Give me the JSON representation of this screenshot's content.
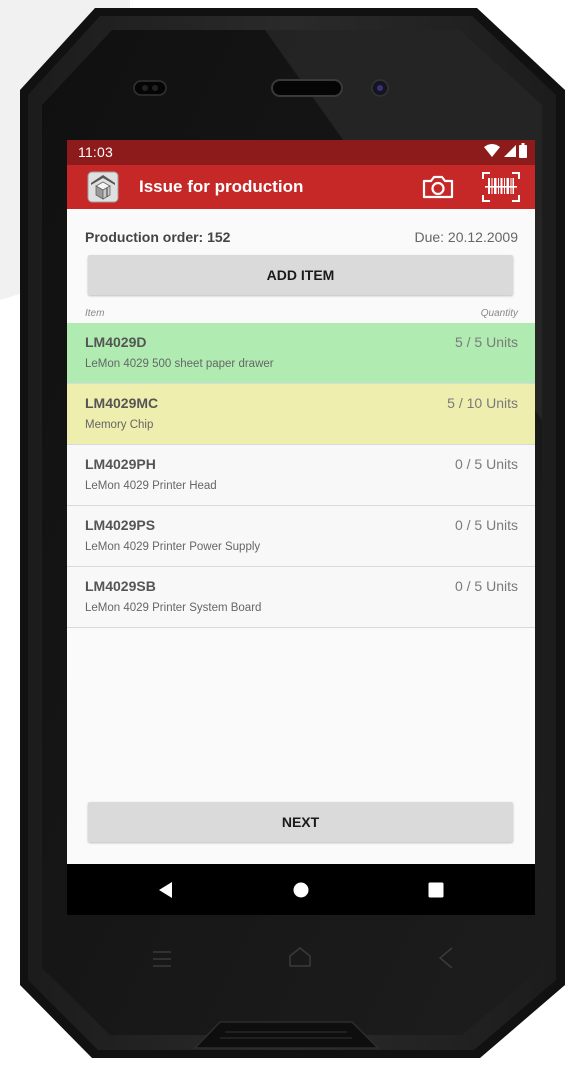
{
  "colors": {
    "accent": "#c62828",
    "status_bar": "#8e1b1b",
    "row_complete": "#b0ecb1",
    "row_partial": "#eeeeaf",
    "row_default": "#f8f8f8"
  },
  "status_bar": {
    "time": "11:03",
    "icons": [
      "wifi-icon",
      "signal-icon",
      "battery-icon"
    ]
  },
  "app_bar": {
    "logo_icon": "warehouse-box-icon",
    "title": "Issue for production",
    "actions": [
      "camera-icon",
      "barcode-icon"
    ]
  },
  "order": {
    "label": "Production order: 152",
    "due": "Due: 20.12.2009"
  },
  "buttons": {
    "add_item": "ADD ITEM",
    "next": "NEXT"
  },
  "list_header": {
    "item": "Item",
    "quantity": "Quantity"
  },
  "items": [
    {
      "code": "LM4029D",
      "description": "LeMon 4029 500 sheet paper drawer",
      "quantity": "5 / 5 Units",
      "status": "complete"
    },
    {
      "code": "LM4029MC",
      "description": "Memory Chip",
      "quantity": "5 / 10 Units",
      "status": "partial"
    },
    {
      "code": "LM4029PH",
      "description": "LeMon 4029 Printer Head",
      "quantity": "0 / 5 Units",
      "status": "none"
    },
    {
      "code": "LM4029PS",
      "description": "LeMon 4029 Printer Power Supply",
      "quantity": "0 / 5 Units",
      "status": "none"
    },
    {
      "code": "LM4029SB",
      "description": "LeMon 4029 Printer System Board",
      "quantity": "0 / 5 Units",
      "status": "none"
    }
  ],
  "nav_bar": {
    "buttons": [
      "back-icon",
      "home-icon",
      "recents-icon"
    ]
  }
}
